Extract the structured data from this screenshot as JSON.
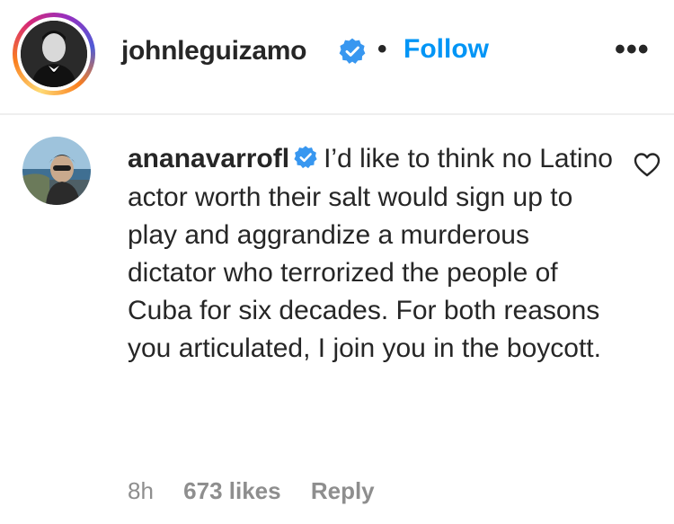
{
  "post_header": {
    "username": "johnleguizamo",
    "separator": "•",
    "follow_label": "Follow",
    "more_label": "•••"
  },
  "comment": {
    "username": "ananavarrofl",
    "text": "I’d like to think no Latino actor worth their salt would sign up to play and aggrandize a murderous dictator who terrorized the people of Cuba for six decades. For both reasons you articulated, I join you in the boycott.",
    "time": "8h",
    "likes": "673 likes",
    "reply_label": "Reply"
  },
  "icons": {
    "verified": "verified-badge-icon",
    "heart": "heart-outline-icon",
    "more": "more-options-icon"
  },
  "colors": {
    "text": "#262626",
    "secondary": "#8e8e8e",
    "link_blue": "#0095f6",
    "verified_blue": "#3897f0",
    "divider": "#efefef"
  }
}
